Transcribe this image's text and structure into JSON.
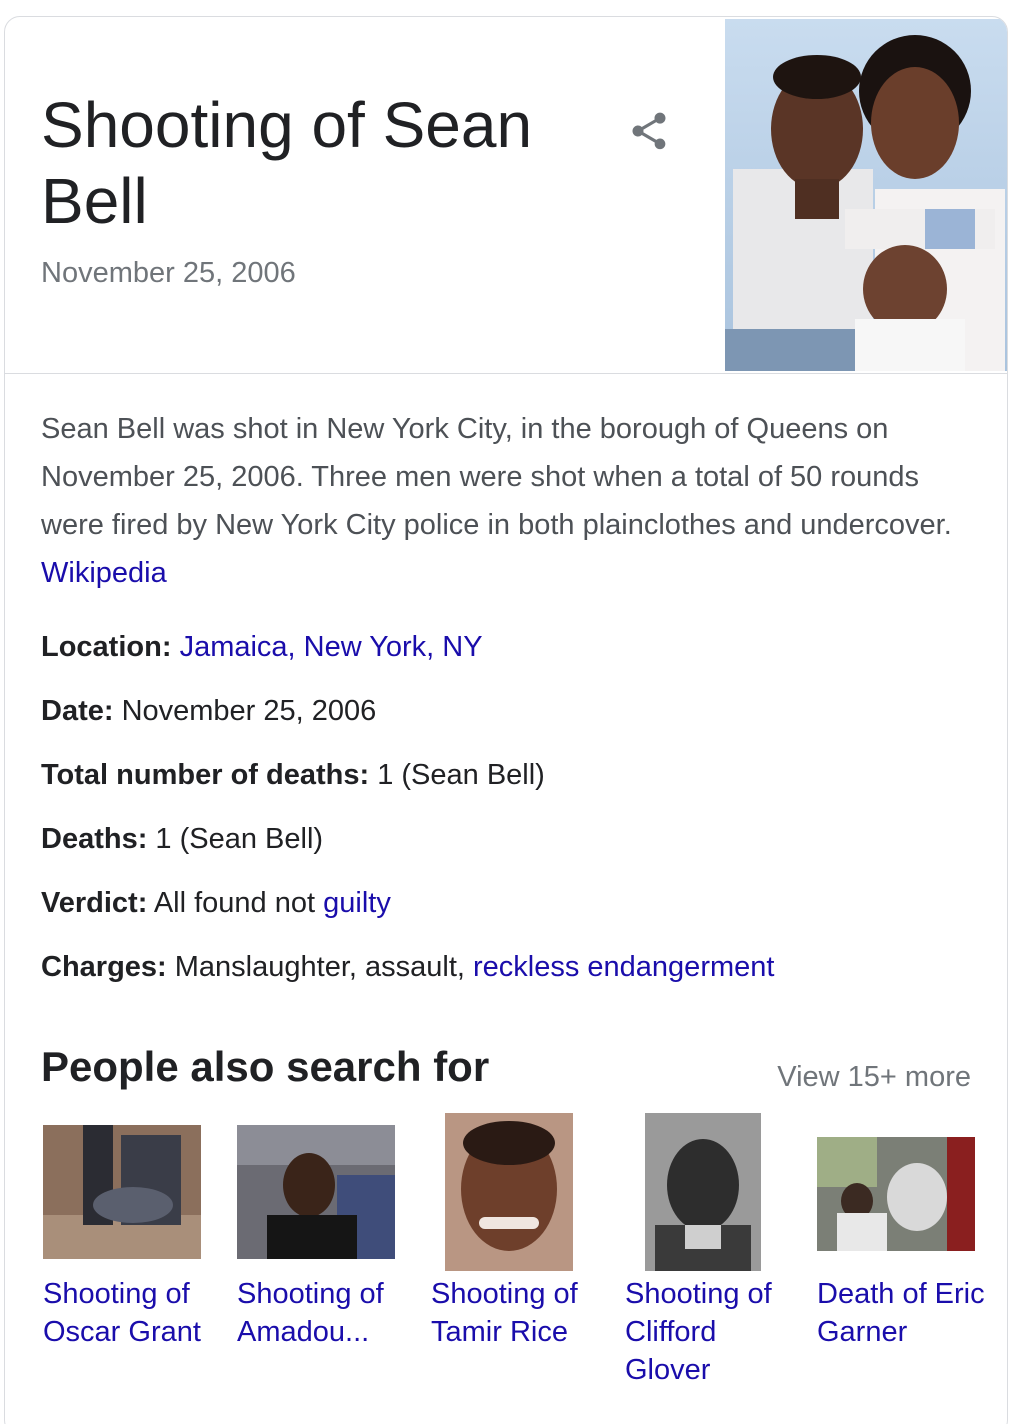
{
  "entity": {
    "title": "Shooting of Sean Bell",
    "subtitle": "November 25, 2006",
    "share_icon": "share-icon"
  },
  "description": {
    "text": "Sean Bell was shot in New York City, in the borough of Queens on November 25, 2006. Three men were shot when a total of 50 rounds were fired by New York City police in both plainclothes and undercover. ",
    "source_link": "Wikipedia"
  },
  "facts": {
    "location": {
      "label": "Location:",
      "value_link": "Jamaica, New York, NY"
    },
    "date": {
      "label": "Date:",
      "value": " November 25, 2006"
    },
    "total_deaths": {
      "label": "Total number of deaths:",
      "value": " 1 (Sean Bell)"
    },
    "deaths": {
      "label": "Deaths:",
      "value": " 1 (Sean Bell)"
    },
    "verdict": {
      "label": "Verdict:",
      "value": " All found not ",
      "value_link": "guilty"
    },
    "charges": {
      "label": "Charges:",
      "value": " Manslaughter, assault, ",
      "value_link": "reckless endangerment"
    }
  },
  "people_also_search": {
    "title": "People also search for",
    "view_more": "View 15+ more",
    "items": [
      {
        "label": "Shooting of Oscar Grant"
      },
      {
        "label": "Shooting of Amadou..."
      },
      {
        "label": "Shooting of Tamir Rice"
      },
      {
        "label": "Shooting of Clifford Glover"
      },
      {
        "label": "Death of Eric Garner"
      }
    ]
  },
  "colors": {
    "link": "#1a0dab",
    "text": "#202124",
    "secondary": "#70757a",
    "border": "#dadce0"
  }
}
